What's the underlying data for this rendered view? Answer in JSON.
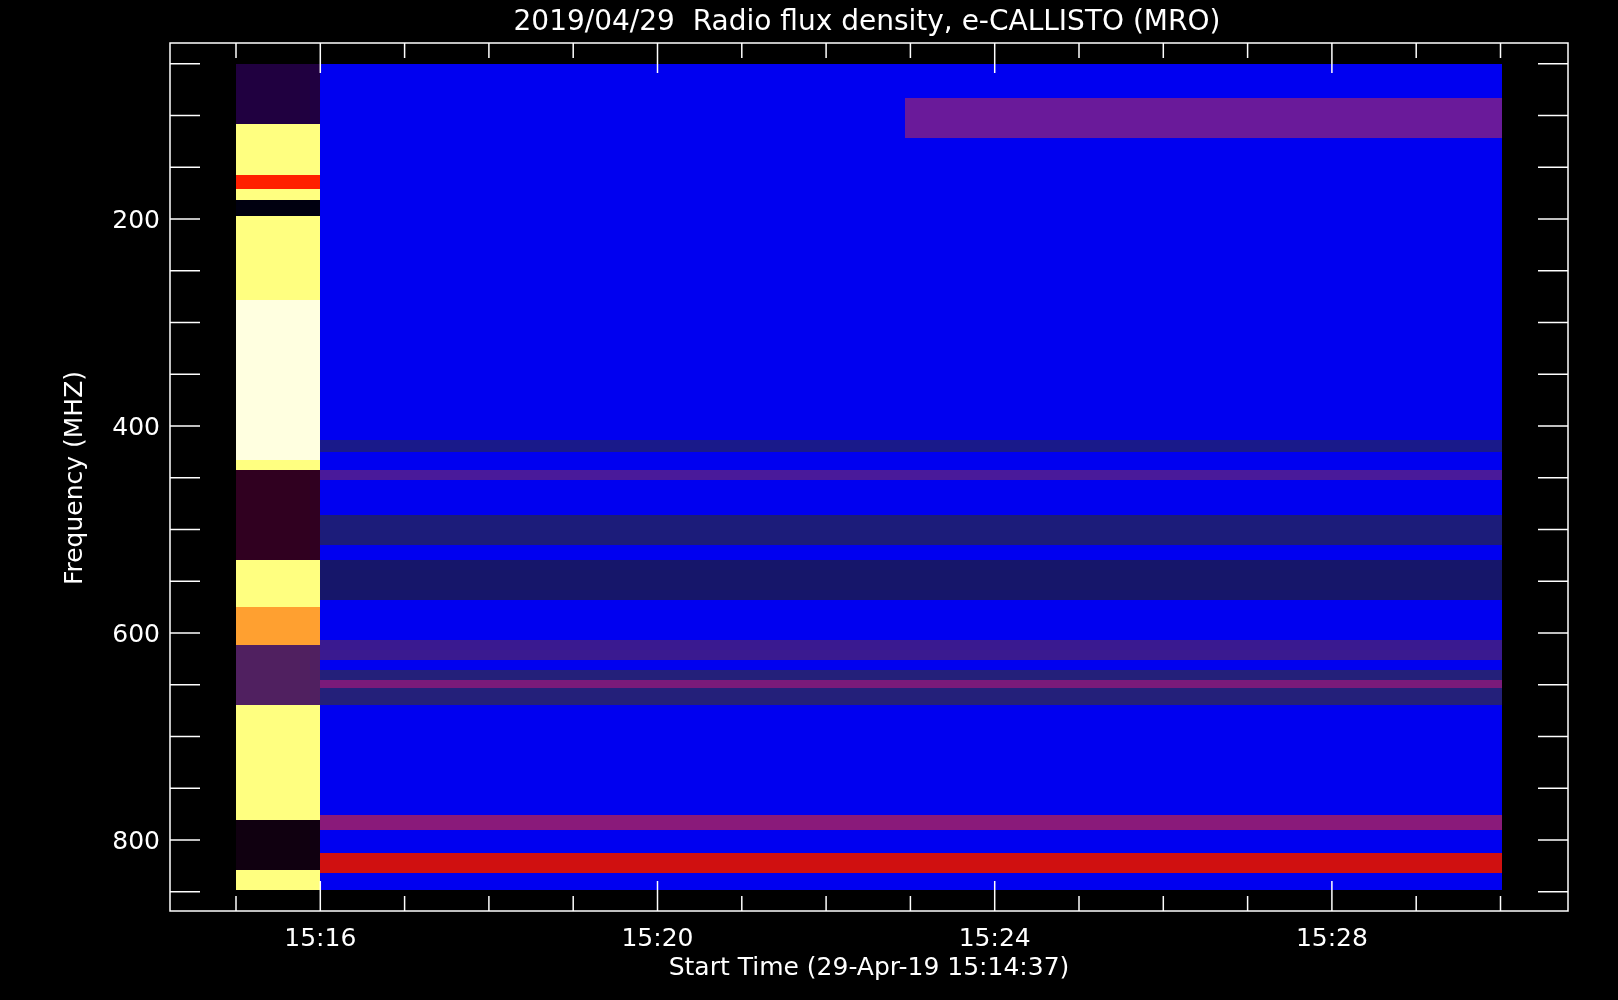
{
  "title": "2019/04/29  Radio flux density, e-CALLISTO (MRO)",
  "y_axis": {
    "label": "Frequency (MHZ)",
    "ticks": [
      "200",
      "400",
      "600",
      "800"
    ]
  },
  "x_axis": {
    "label": "Start Time (29-Apr-19 15:14:37)",
    "ticks": [
      "15:16",
      "15:20",
      "15:24",
      "15:28"
    ]
  }
}
